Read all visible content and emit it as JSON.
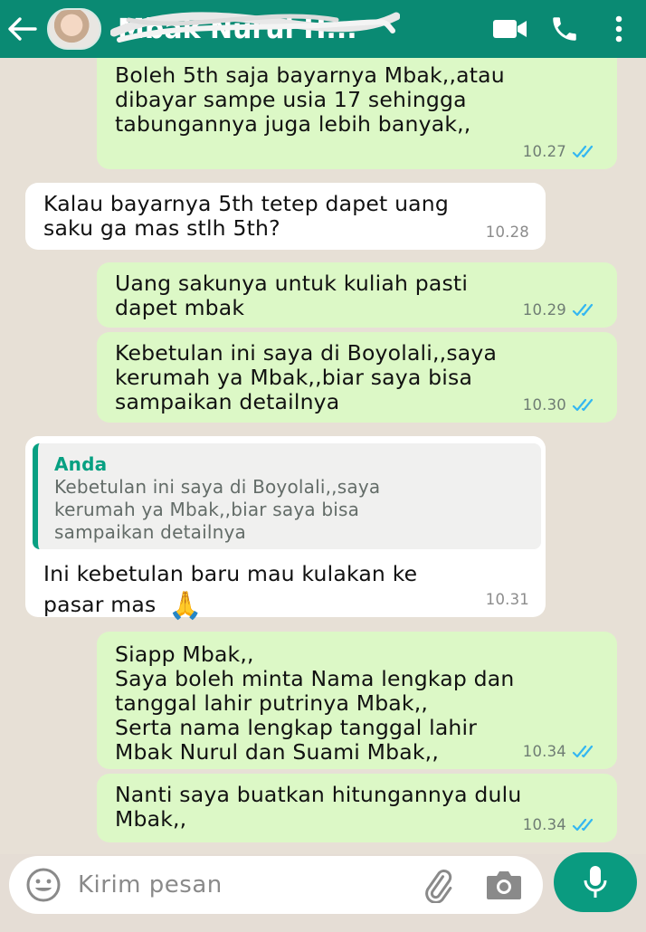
{
  "header": {
    "contact_name": "Mbak Nurul H...",
    "colors": {
      "bar": "#0a8a73"
    }
  },
  "messages": [
    {
      "id": "m1",
      "direction": "out",
      "text": "Boleh 5th saja bayarnya Mbak,,atau\ndibayar sampe usia 17 sehingga\ntabungannya juga lebih banyak,,",
      "time": "10.27",
      "status": "read"
    },
    {
      "id": "m2",
      "direction": "in",
      "text": "Kalau bayarnya 5th tetep dapet uang\nsaku ga mas stlh 5th?",
      "time": "10.28"
    },
    {
      "id": "m3",
      "direction": "out",
      "text": "Uang sakunya untuk kuliah pasti\ndapet mbak",
      "time": "10.29",
      "status": "read"
    },
    {
      "id": "m4",
      "direction": "out",
      "text": "Kebetulan ini saya di Boyolali,,saya\nkerumah ya Mbak,,biar saya bisa\nsampaikan detailnya",
      "time": "10.30",
      "status": "read"
    },
    {
      "id": "m5",
      "direction": "in",
      "quote_author": "Anda",
      "quote_text": "Kebetulan ini saya di Boyolali,,saya\nkerumah ya Mbak,,biar saya bisa\nsampaikan detailnya",
      "text": "Ini kebetulan baru mau kulakan ke\npasar mas",
      "emoji": "🙏",
      "time": "10.31"
    },
    {
      "id": "m6",
      "direction": "out",
      "text": "Siapp Mbak,,\nSaya boleh minta Nama lengkap dan\ntanggal lahir putrinya Mbak,,\nSerta nama lengkap tanggal lahir\nMbak Nurul dan Suami Mbak,,",
      "time": "10.34",
      "status": "read"
    },
    {
      "id": "m7",
      "direction": "out",
      "text": "Nanti saya buatkan hitungannya dulu\nMbak,,",
      "time": "10.34",
      "status": "read"
    }
  ],
  "input": {
    "placeholder": "Kirim pesan"
  },
  "icons": [
    "back-arrow-icon",
    "video-call-icon",
    "phone-icon",
    "more-vert-icon",
    "emoji-icon",
    "attach-icon",
    "camera-icon",
    "mic-icon",
    "double-check-icon"
  ],
  "colors": {
    "outgoing": "#dcf8c6",
    "incoming": "#ffffff",
    "tick_read": "#34b7f1",
    "accent": "#07a082"
  }
}
